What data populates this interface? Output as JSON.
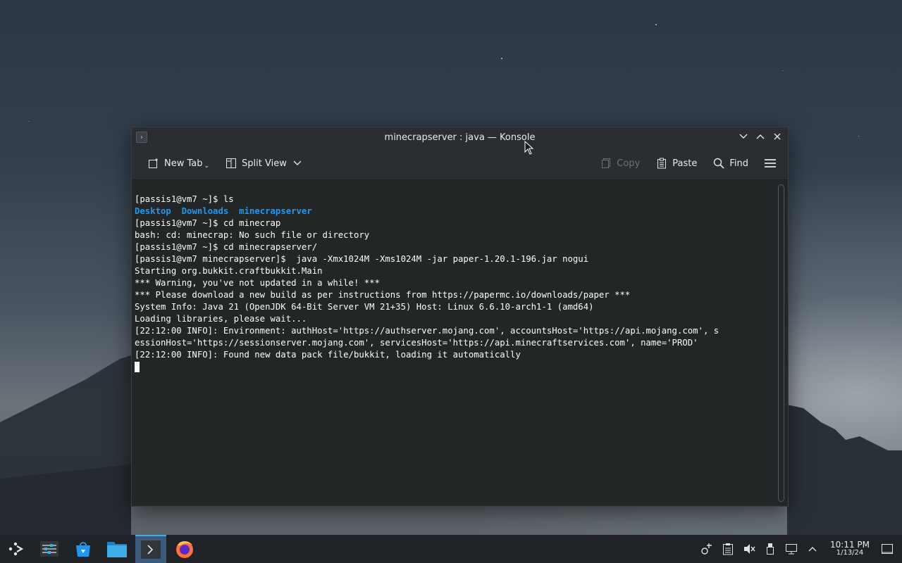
{
  "window": {
    "title": "minecrapserver : java — Konsole"
  },
  "toolbar": {
    "new_tab": "New Tab",
    "split_view": "Split View",
    "copy": "Copy",
    "paste": "Paste",
    "find": "Find"
  },
  "terminal": {
    "lines": [
      "[passis1@vm7 ~]$ ls",
      "",
      "[passis1@vm7 ~]$ cd minecrap",
      "bash: cd: minecrap: No such file or directory",
      "[passis1@vm7 ~]$ cd minecrapserver/",
      "[passis1@vm7 minecrapserver]$  java -Xmx1024M -Xms1024M -jar paper-1.20.1-196.jar nogui",
      "Starting org.bukkit.craftbukkit.Main",
      "*** Warning, you've not updated in a while! ***",
      "*** Please download a new build as per instructions from https://papermc.io/downloads/paper ***",
      "System Info: Java 21 (OpenJDK 64-Bit Server VM 21+35) Host: Linux 6.6.10-arch1-1 (amd64)",
      "Loading libraries, please wait...",
      "[22:12:00 INFO]: Environment: authHost='https://authserver.mojang.com', accountsHost='https://api.mojang.com', s",
      "essionHost='https://sessionserver.mojang.com', servicesHost='https://api.minecraftservices.com', name='PROD'",
      "[22:12:00 INFO]: Found new data pack file/bukkit, loading it automatically"
    ],
    "ls_output": [
      "Desktop",
      "Downloads",
      "minecrapserver"
    ],
    "dir_color": "#1d99f3"
  },
  "taskbar": {
    "items": [
      "app-launcher-icon",
      "system-settings-icon",
      "discover-icon",
      "dolphin-icon",
      "konsole-icon",
      "firefox-icon"
    ],
    "active": "konsole-icon"
  },
  "tray": {
    "time": "10:11 PM",
    "date": "1/13/24"
  }
}
